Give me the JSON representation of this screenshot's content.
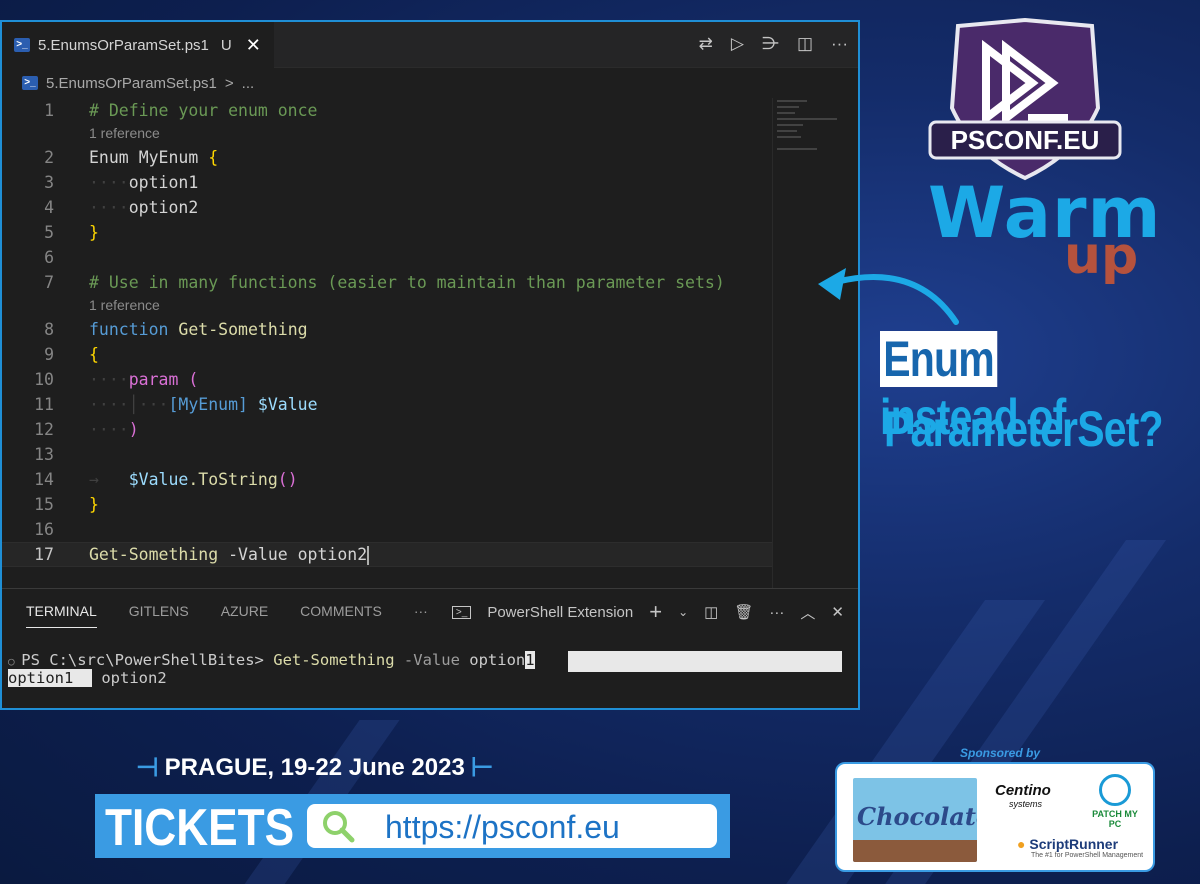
{
  "editor": {
    "tab": {
      "filename": "5.EnumsOrParamSet.ps1",
      "status": "U",
      "close": "✕",
      "icon": "powershell-icon"
    },
    "breadcrumb": {
      "file": "5.EnumsOrParamSet.ps1",
      "sep": ">",
      "more": "..."
    },
    "toolbar_icons": [
      "compare-changes-icon",
      "run-icon",
      "run-selection-icon",
      "split-editor-icon",
      "more-icon"
    ],
    "code_lines": [
      {
        "n": "1",
        "text": "# Define your enum once"
      },
      {
        "lens": "1 reference"
      },
      {
        "n": "2",
        "text": "Enum MyEnum {"
      },
      {
        "n": "3",
        "text": "option1"
      },
      {
        "n": "4",
        "text": "option2"
      },
      {
        "n": "5",
        "text": "}"
      },
      {
        "n": "6",
        "text": ""
      },
      {
        "n": "7",
        "text": "# Use in many functions (easier to maintain than parameter sets)"
      },
      {
        "lens": "1 reference"
      },
      {
        "n": "8",
        "text": "function Get-Something"
      },
      {
        "n": "9",
        "text": "{"
      },
      {
        "n": "10",
        "text": "param ("
      },
      {
        "n": "11",
        "text": "[MyEnum] $Value"
      },
      {
        "n": "12",
        "text": ")"
      },
      {
        "n": "13",
        "text": ""
      },
      {
        "n": "14",
        "text": "$Value.ToString()"
      },
      {
        "n": "15",
        "text": "}"
      },
      {
        "n": "16",
        "text": ""
      },
      {
        "n": "17",
        "text": "Get-Something -Value option2"
      }
    ],
    "tokens": {
      "l1": "# Define your enum once",
      "l2_kw": "Enum",
      "l2_name": "MyEnum",
      "l2_brace": "{",
      "l3": "option1",
      "l4": "option2",
      "l5": "}",
      "l7": "# Use in many functions (easier to maintain than parameter sets)",
      "l8_kw": "function",
      "l8_fn": "Get-Something",
      "l9": "{",
      "l10_kw": "param",
      "l10_paren": "(",
      "l11_type": "[MyEnum]",
      "l11_var": "$Value",
      "l12": ")",
      "l14_var": "$Value",
      "l14_method": ".ToString",
      "l14_paren": "()",
      "l15": "}",
      "l17_cmd": "Get-Something",
      "l17_param": "-Value",
      "l17_arg": "option2",
      "lens": "1 reference"
    }
  },
  "panel": {
    "tabs": [
      "TERMINAL",
      "GITLENS",
      "AZURE",
      "COMMENTS"
    ],
    "more": "···",
    "shell": "PowerShell Extension",
    "prompt": "PS C:\\src\\PowerShellBites>",
    "command": "Get-Something",
    "param": "-Value",
    "typed": "option",
    "typed_sel": "1",
    "completions": [
      "option1",
      "option2"
    ]
  },
  "branding": {
    "logo_text": "PSCONF.EU",
    "warm": "Warm",
    "up": "up",
    "q_highlight": "Enum",
    "q_rest": "instead of",
    "q_line2": "ParameterSet?",
    "colors": {
      "accent": "#1ca9e6",
      "up": "#b5523d",
      "border": "#1f8fd6"
    }
  },
  "footer": {
    "event": "PRAGUE, 19-22 June 2023",
    "tickets": "TICKETS",
    "url": "https://psconf.eu",
    "sponsored_by": "Sponsored by",
    "sponsors": {
      "chocolatey": "Chocolatey",
      "centino": "Centino",
      "centino_sub": "systems",
      "patch": "PATCH MY PC",
      "script": "ScriptRunner",
      "script_sub": "The #1 for PowerShell Management"
    }
  }
}
